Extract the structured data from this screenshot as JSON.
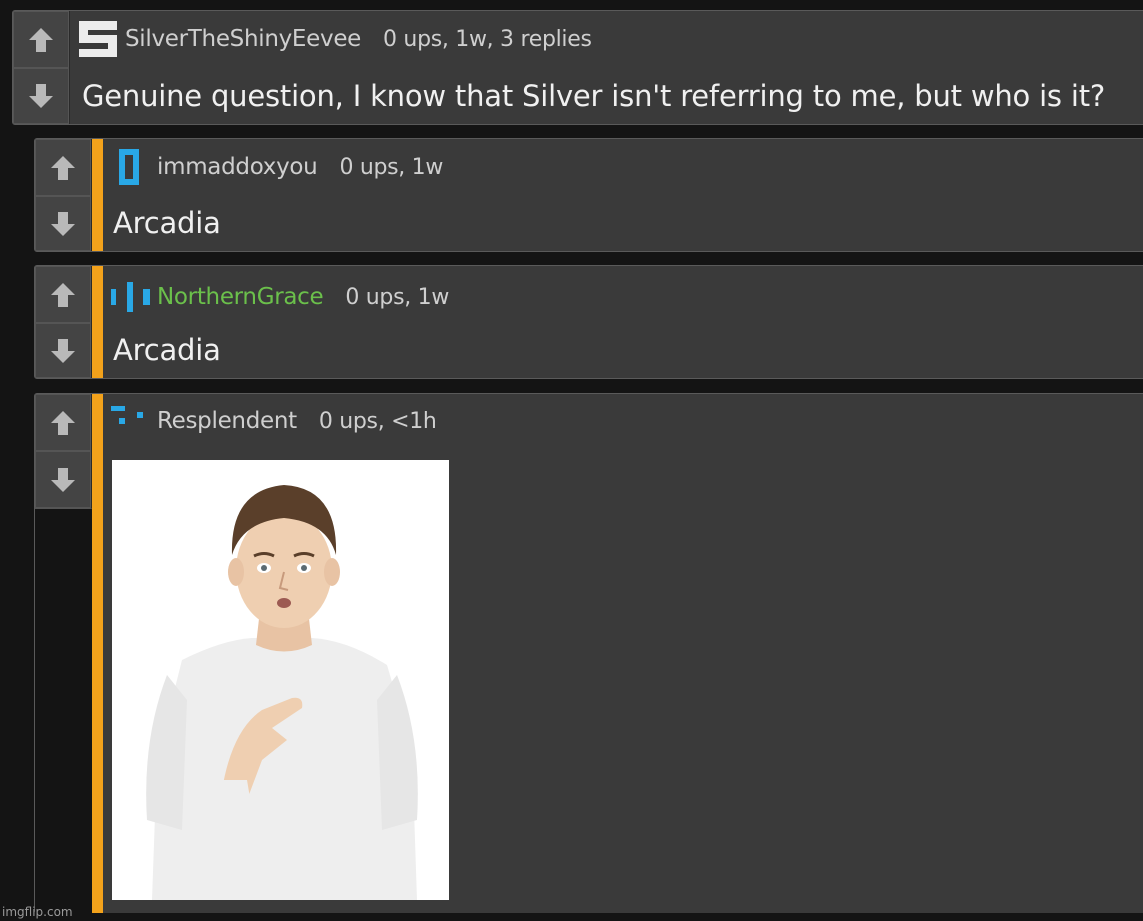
{
  "comments": [
    {
      "username": "SilverTheShinyEevee",
      "stats": "0 ups, 1w, 3 replies",
      "text": "Genuine question, I know that Silver isn't referring to me, but who is it?"
    },
    {
      "username": "immaddoxyou",
      "stats": "0 ups, 1w",
      "text": "Arcadia"
    },
    {
      "username": "NorthernGrace",
      "stats": "0 ups, 1w",
      "text": "Arcadia"
    },
    {
      "username": "Resplendent",
      "stats": "0 ups, <1h",
      "image": "photo of a young man in a white t-shirt pointing at himself"
    }
  ],
  "watermark": "imgflip.com",
  "colors": {
    "background": "#141414",
    "panel": "#3a3a3a",
    "reply_bar": "#f3a21b",
    "username_green": "#6bc04b",
    "avatar_blue": "#29a8e6"
  },
  "icons": [
    "upvote-arrow-icon",
    "downvote-arrow-icon"
  ]
}
